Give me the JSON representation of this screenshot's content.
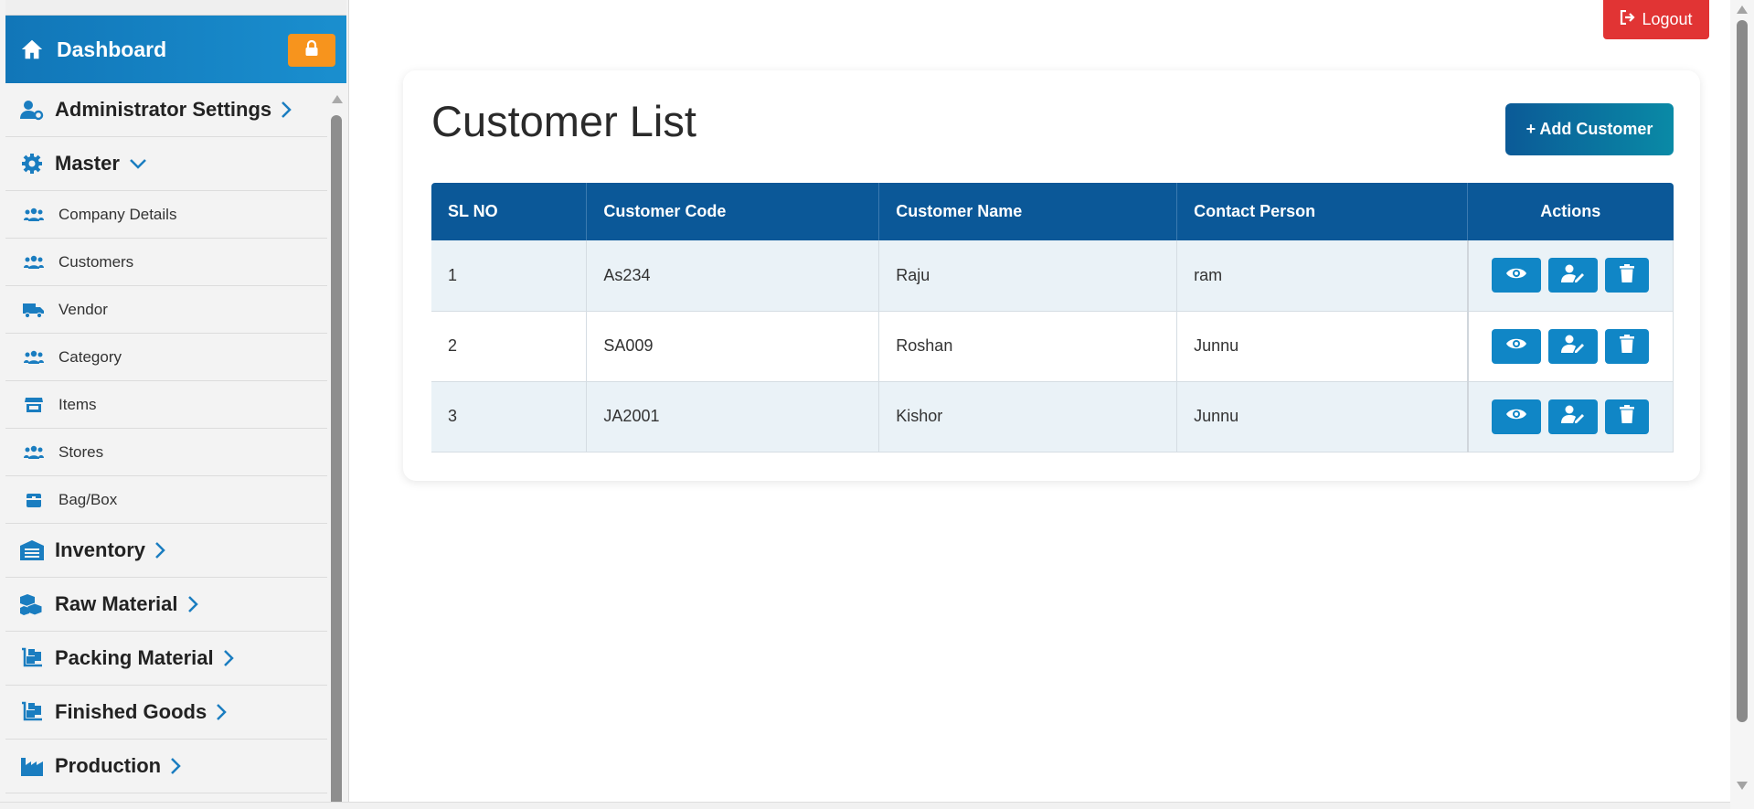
{
  "sidebar": {
    "dashboard_label": "Dashboard",
    "items": [
      {
        "label": "Administrator Settings",
        "icon": "user-gear-icon",
        "size": "big",
        "chevron": "right"
      },
      {
        "label": "Master",
        "icon": "gear-icon",
        "size": "big",
        "chevron": "down"
      },
      {
        "label": "Company Details",
        "icon": "users-icon",
        "size": "small"
      },
      {
        "label": "Customers",
        "icon": "users-icon",
        "size": "small"
      },
      {
        "label": "Vendor",
        "icon": "truck-icon",
        "size": "small"
      },
      {
        "label": "Category",
        "icon": "users-icon",
        "size": "small"
      },
      {
        "label": "Items",
        "icon": "store-icon",
        "size": "small"
      },
      {
        "label": "Stores",
        "icon": "users-icon",
        "size": "small"
      },
      {
        "label": "Bag/Box",
        "icon": "box-icon",
        "size": "small"
      },
      {
        "label": "Inventory",
        "icon": "warehouse-icon",
        "size": "big",
        "chevron": "right"
      },
      {
        "label": "Raw Material",
        "icon": "boxes-icon",
        "size": "big",
        "chevron": "right"
      },
      {
        "label": "Packing Material",
        "icon": "dolly-icon",
        "size": "big",
        "chevron": "right"
      },
      {
        "label": "Finished Goods",
        "icon": "dolly-icon",
        "size": "big",
        "chevron": "right"
      },
      {
        "label": "Production",
        "icon": "industry-icon",
        "size": "big",
        "chevron": "right"
      }
    ]
  },
  "header": {
    "logout_label": "Logout"
  },
  "main": {
    "title": "Customer List",
    "add_button_label": "+ Add Customer",
    "table": {
      "columns": [
        "SL NO",
        "Customer Code",
        "Customer Name",
        "Contact Person",
        "Actions"
      ],
      "rows": [
        [
          "1",
          "As234",
          "Raju",
          "ram"
        ],
        [
          "2",
          "SA009",
          "Roshan",
          "Junnu"
        ],
        [
          "3",
          "JA2001",
          "Kishor",
          "Junnu"
        ]
      ]
    }
  },
  "colors": {
    "brand_blue": "#0b5898",
    "accent_blue": "#1086c6",
    "logout_red": "#e13434",
    "lock_orange": "#f7941d"
  }
}
